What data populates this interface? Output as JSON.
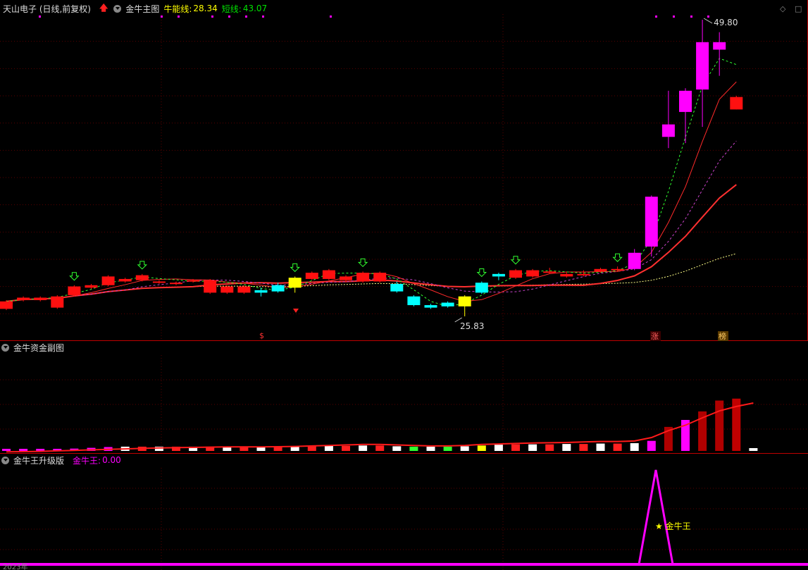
{
  "header": {
    "stock": "天山电子 (日线,前复权)",
    "indicator": "金牛主图",
    "bull_line_label": "牛能线:",
    "bull_line_value": "28.34",
    "short_line_label": "短线:",
    "short_line_value": "43.07"
  },
  "main_chart": {
    "high_label": "49.80",
    "low_label": "25.83",
    "tag_zhang": "涨",
    "tag_bang": "榜",
    "dollar_marker": "$"
  },
  "sub1": {
    "title": "金牛资金副图"
  },
  "sub2": {
    "title": "金牛王升级版",
    "value_label": "金牛王:",
    "value": "0.00",
    "annotation": "★ 金牛王"
  },
  "bottom_axis": {
    "left_label": "2023年"
  },
  "colors": {
    "up": "#ff1010",
    "down": "#00ffff",
    "magenta": "#ff00ff",
    "yellow": "#ffff00",
    "grid": "#5a0000",
    "border": "#c00000"
  },
  "chart_data": {
    "type": "candlestick",
    "candles": [
      {
        "o": 26.6,
        "c": 27.2,
        "h": 27.3,
        "l": 26.5,
        "t": "up"
      },
      {
        "o": 27.3,
        "c": 27.5,
        "h": 27.6,
        "l": 27.2,
        "t": "up"
      },
      {
        "o": 27.3,
        "c": 27.5,
        "h": 27.6,
        "l": 27.2,
        "t": "up"
      },
      {
        "o": 26.7,
        "c": 27.6,
        "h": 27.7,
        "l": 26.6,
        "t": "up"
      },
      {
        "o": 27.7,
        "c": 28.4,
        "h": 28.5,
        "l": 27.6,
        "t": "up"
      },
      {
        "o": 28.3,
        "c": 28.5,
        "h": 28.6,
        "l": 28.2,
        "t": "up"
      },
      {
        "o": 28.5,
        "c": 29.2,
        "h": 29.3,
        "l": 28.4,
        "t": "up"
      },
      {
        "o": 28.8,
        "c": 29.0,
        "h": 29.1,
        "l": 28.7,
        "t": "up"
      },
      {
        "o": 28.9,
        "c": 29.3,
        "h": 29.4,
        "l": 28.8,
        "t": "up"
      },
      {
        "o": 28.7,
        "c": 28.8,
        "h": 28.9,
        "l": 28.6,
        "t": "up"
      },
      {
        "o": 28.6,
        "c": 28.7,
        "h": 28.8,
        "l": 28.5,
        "t": "up"
      },
      {
        "o": 28.8,
        "c": 28.9,
        "h": 29.0,
        "l": 28.7,
        "t": "up"
      },
      {
        "o": 27.9,
        "c": 28.9,
        "h": 29.0,
        "l": 27.8,
        "t": "up"
      },
      {
        "o": 27.9,
        "c": 28.4,
        "h": 28.5,
        "l": 27.8,
        "t": "up"
      },
      {
        "o": 27.9,
        "c": 28.4,
        "h": 28.5,
        "l": 27.8,
        "t": "up"
      },
      {
        "o": 28.1,
        "c": 27.9,
        "h": 28.3,
        "l": 27.6,
        "t": "down"
      },
      {
        "o": 28.5,
        "c": 28.0,
        "h": 28.7,
        "l": 27.9,
        "t": "down"
      },
      {
        "o": 28.3,
        "c": 29.1,
        "h": 29.2,
        "l": 27.9,
        "t": "yellow"
      },
      {
        "o": 29.0,
        "c": 29.5,
        "h": 29.6,
        "l": 28.9,
        "t": "up"
      },
      {
        "o": 29.0,
        "c": 29.7,
        "h": 29.8,
        "l": 28.9,
        "t": "up"
      },
      {
        "o": 28.9,
        "c": 29.2,
        "h": 29.3,
        "l": 28.8,
        "t": "up"
      },
      {
        "o": 28.8,
        "c": 29.5,
        "h": 29.6,
        "l": 28.7,
        "t": "up"
      },
      {
        "o": 28.8,
        "c": 29.5,
        "h": 29.6,
        "l": 28.7,
        "t": "up"
      },
      {
        "o": 28.6,
        "c": 28.0,
        "h": 28.8,
        "l": 27.9,
        "t": "down"
      },
      {
        "o": 27.6,
        "c": 26.9,
        "h": 27.7,
        "l": 26.8,
        "t": "down"
      },
      {
        "o": 26.9,
        "c": 26.7,
        "h": 27.0,
        "l": 26.6,
        "t": "down"
      },
      {
        "o": 27.1,
        "c": 26.8,
        "h": 27.2,
        "l": 26.7,
        "t": "down"
      },
      {
        "o": 26.8,
        "c": 27.6,
        "h": 27.7,
        "l": 26.0,
        "t": "yellow"
      },
      {
        "o": 27.9,
        "c": 28.7,
        "h": 28.8,
        "l": 27.8,
        "t": "down"
      },
      {
        "o": 29.2,
        "c": 29.4,
        "h": 29.5,
        "l": 28.9,
        "t": "down"
      },
      {
        "o": 29.1,
        "c": 29.7,
        "h": 29.8,
        "l": 29.0,
        "t": "up"
      },
      {
        "o": 29.2,
        "c": 29.7,
        "h": 29.8,
        "l": 29.1,
        "t": "up"
      },
      {
        "o": 29.5,
        "c": 29.6,
        "h": 29.9,
        "l": 29.4,
        "t": "up"
      },
      {
        "o": 29.2,
        "c": 29.4,
        "h": 29.6,
        "l": 29.1,
        "t": "up"
      },
      {
        "o": 29.3,
        "c": 29.4,
        "h": 29.7,
        "l": 29.2,
        "t": "up"
      },
      {
        "o": 29.6,
        "c": 29.8,
        "h": 29.9,
        "l": 29.5,
        "t": "up"
      },
      {
        "o": 29.7,
        "c": 29.8,
        "h": 30.0,
        "l": 29.6,
        "t": "up"
      },
      {
        "o": 29.8,
        "c": 31.1,
        "h": 31.4,
        "l": 29.7,
        "t": "mag"
      },
      {
        "o": 31.6,
        "c": 35.6,
        "h": 35.7,
        "l": 30.8,
        "t": "mag"
      },
      {
        "o": 40.4,
        "c": 41.4,
        "h": 44.1,
        "l": 39.5,
        "t": "mag"
      },
      {
        "o": 42.4,
        "c": 44.1,
        "h": 44.3,
        "l": 39.9,
        "t": "mag"
      },
      {
        "o": 44.2,
        "c": 48.0,
        "h": 49.8,
        "l": 41.2,
        "t": "mag"
      },
      {
        "o": 47.4,
        "c": 48.0,
        "h": 48.8,
        "l": 45.3,
        "t": "mag"
      },
      {
        "o": 43.6,
        "c": 42.6,
        "h": 43.7,
        "l": 42.6,
        "t": "up"
      }
    ]
  }
}
